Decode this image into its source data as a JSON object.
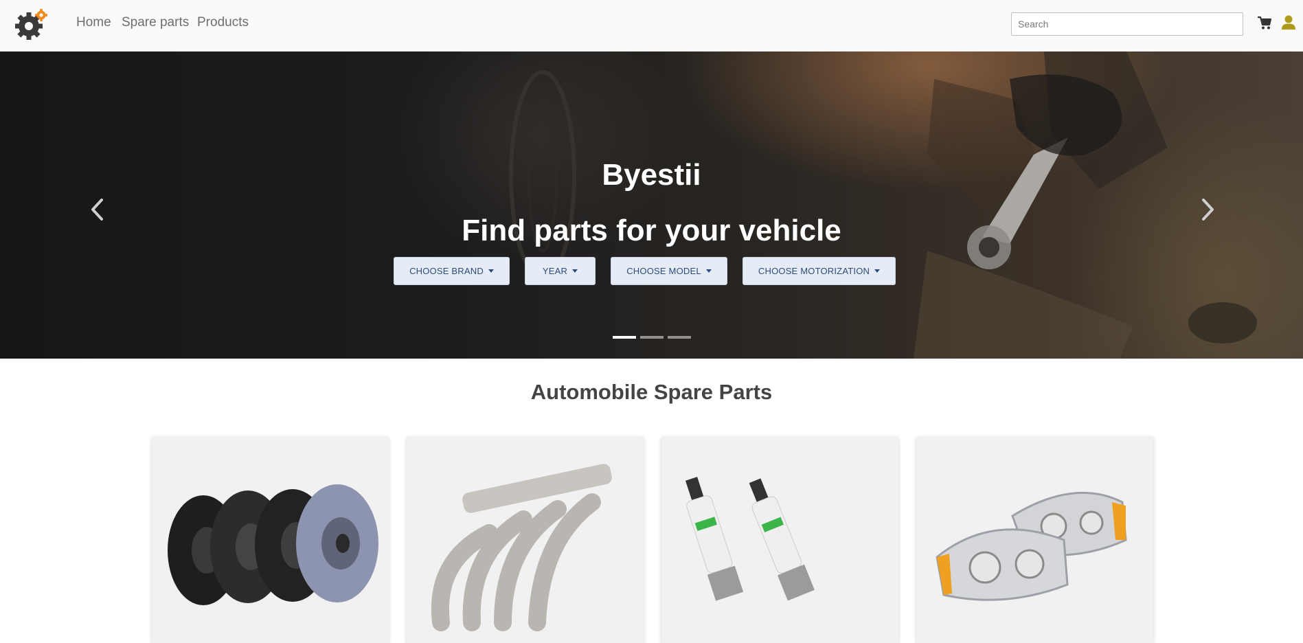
{
  "navbar": {
    "logo_icon": "gear-logo-icon",
    "links": [
      "Home",
      "Spare parts",
      "Products"
    ],
    "search_placeholder": "Search",
    "cart_icon": "cart-icon",
    "user_icon": "user-icon",
    "accent": "#b09a1a"
  },
  "hero": {
    "title": "Byestii",
    "subtitle": "Find parts for your vehicle",
    "buttons": {
      "brand": "CHOOSE BRAND",
      "year": "YEAR",
      "model": "CHOOSE MODEL",
      "motorization": "CHOOSE MOTORIZATION"
    },
    "prev_icon": "chevron-left-icon",
    "next_icon": "chevron-right-icon",
    "slides": 3,
    "active_slide": 1
  },
  "section": {
    "title": "Automobile Spare Parts",
    "cards": [
      {
        "icon": "brake-discs-image"
      },
      {
        "icon": "intake-manifold-image"
      },
      {
        "icon": "spark-plugs-image"
      },
      {
        "icon": "headlights-image"
      }
    ]
  }
}
